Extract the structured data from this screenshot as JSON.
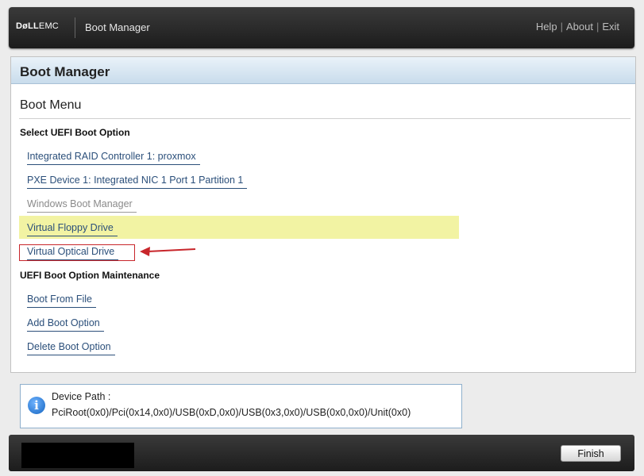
{
  "header": {
    "brand_dell": "DøLL",
    "brand_emc": "EMC",
    "app_title": "Boot Manager",
    "links": [
      "Help",
      "About",
      "Exit"
    ],
    "link_separator": "|"
  },
  "panel": {
    "title": "Boot Manager",
    "section_title": "Boot Menu",
    "groups": [
      {
        "label": "Select UEFI Boot Option",
        "options": [
          {
            "label": "Integrated RAID Controller 1: proxmox",
            "state": "normal"
          },
          {
            "label": "PXE Device 1: Integrated NIC 1 Port 1 Partition 1",
            "state": "normal"
          },
          {
            "label": "Windows Boot Manager",
            "state": "disabled"
          },
          {
            "label": "Virtual Floppy Drive",
            "state": "highlighted"
          },
          {
            "label": "Virtual Optical Drive",
            "state": "annotated"
          }
        ]
      },
      {
        "label": "UEFI Boot Option Maintenance",
        "options": [
          {
            "label": "Boot From File",
            "state": "normal"
          },
          {
            "label": "Add Boot Option",
            "state": "normal"
          },
          {
            "label": "Delete Boot Option",
            "state": "normal"
          }
        ]
      }
    ]
  },
  "info": {
    "icon": "info-icon",
    "label": "Device Path :",
    "value": "PciRoot(0x0)/Pci(0x14,0x0)/USB(0xD,0x0)/USB(0x3,0x0)/USB(0x0,0x0)/Unit(0x0)"
  },
  "footer": {
    "finish_label": "Finish"
  },
  "colors": {
    "highlight": "#f2f3a3",
    "annotation": "#c8262b",
    "link": "#2b4f7a"
  }
}
